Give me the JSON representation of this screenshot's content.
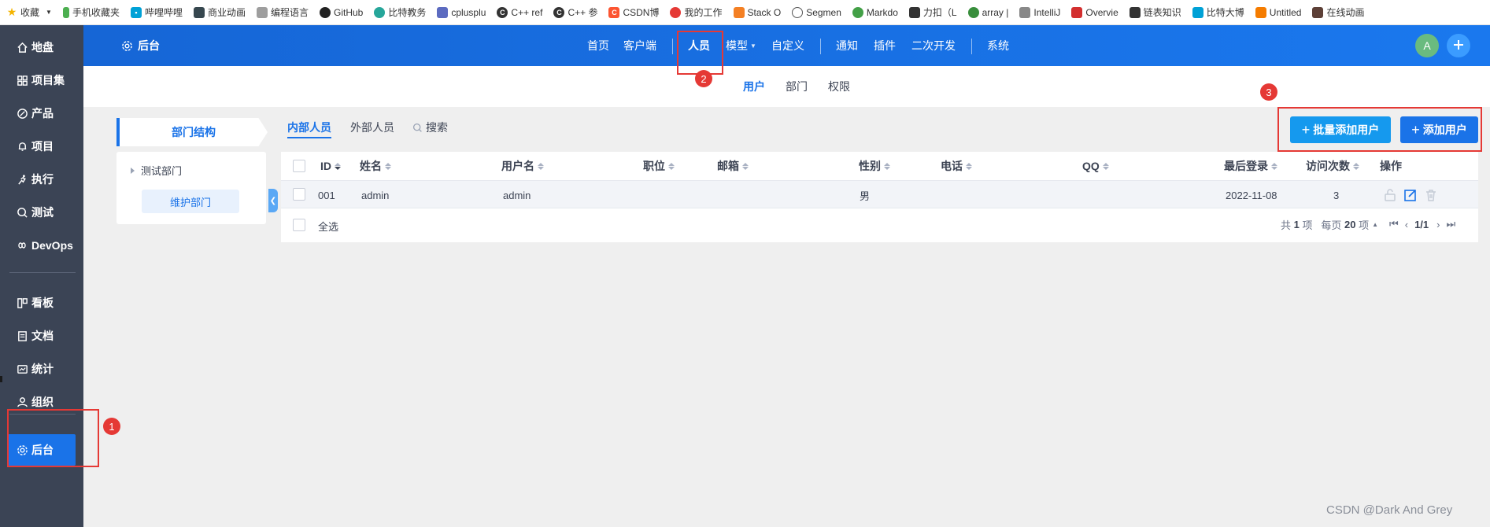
{
  "bookmarks": [
    {
      "label": "收藏",
      "icon": "star-icon",
      "color": "#f4b400"
    },
    {
      "label": "手机收藏夹",
      "icon": "phone-icon",
      "color": "#4caf50"
    },
    {
      "label": "哔哩哔哩",
      "icon": "bilibili-icon",
      "color": "#00a1d6"
    },
    {
      "label": "商业动画",
      "icon": "animation-icon",
      "color": "#37474f"
    },
    {
      "label": "编程语言",
      "icon": "code-icon",
      "color": "#9e9e9e"
    },
    {
      "label": "GitHub",
      "icon": "github-icon",
      "color": "#222222"
    },
    {
      "label": "比特教务",
      "icon": "leaf-icon",
      "color": "#26a69a"
    },
    {
      "label": "cplusplu",
      "icon": "cplusplus-icon",
      "color": "#5c6bc0"
    },
    {
      "label": "C++ ref",
      "icon": "cpp-icon",
      "color": "#333333"
    },
    {
      "label": "C++ 参",
      "icon": "cpp-icon",
      "color": "#333333"
    },
    {
      "label": "CSDN博",
      "icon": "csdn-icon",
      "color": "#fc5531"
    },
    {
      "label": "我的工作",
      "icon": "work-icon",
      "color": "#e53935"
    },
    {
      "label": "Stack O",
      "icon": "stackoverflow-icon",
      "color": "#f48024"
    },
    {
      "label": "Segmen",
      "icon": "globe-icon",
      "color": "#555555"
    },
    {
      "label": "Markdo",
      "icon": "markdown-icon",
      "color": "#43a047"
    },
    {
      "label": "力扣（L",
      "icon": "leetcode-icon",
      "color": "#333333"
    },
    {
      "label": "array |",
      "icon": "array-icon",
      "color": "#388e3c"
    },
    {
      "label": "IntelliJ",
      "icon": "intellij-icon",
      "color": "#888888"
    },
    {
      "label": "Overvie",
      "icon": "overview-icon",
      "color": "#d32f2f"
    },
    {
      "label": "链表知识",
      "icon": "leetcode-icon",
      "color": "#333333"
    },
    {
      "label": "比特大博",
      "icon": "bilibili-icon",
      "color": "#00a1d6"
    },
    {
      "label": "Untitled",
      "icon": "grid-icon",
      "color": "#f57c00"
    },
    {
      "label": "在线动画",
      "icon": "anime-icon",
      "color": "#5d4037"
    }
  ],
  "sidebar": {
    "items": [
      {
        "label": "地盘",
        "icon": "home-icon"
      },
      {
        "label": "项目集",
        "icon": "grid-icon"
      },
      {
        "label": "产品",
        "icon": "product-icon"
      },
      {
        "label": "项目",
        "icon": "bell-icon"
      },
      {
        "label": "执行",
        "icon": "run-icon"
      },
      {
        "label": "测试",
        "icon": "test-icon"
      },
      {
        "label": "DevOps",
        "icon": "infinity-icon"
      },
      {
        "label": "看板",
        "icon": "board-icon"
      },
      {
        "label": "文档",
        "icon": "doc-icon"
      },
      {
        "label": "统计",
        "icon": "chart-icon"
      },
      {
        "label": "组织",
        "icon": "user-icon"
      },
      {
        "label": "后台",
        "icon": "gear-icon",
        "active": true
      }
    ]
  },
  "header": {
    "brand": "后台",
    "nav": [
      "首页",
      "客户端",
      "人员",
      "模型",
      "自定义",
      "通知",
      "插件",
      "二次开发",
      "系统"
    ],
    "active_nav": "人员",
    "avatar_letter": "A"
  },
  "subnav": {
    "items": [
      "用户",
      "部门",
      "权限"
    ],
    "active": "用户"
  },
  "dept": {
    "title": "部门结构",
    "tree_root": "测试部门",
    "tree_child": "维护部门"
  },
  "tabs": {
    "internal": "内部人员",
    "external": "外部人员",
    "search": "搜索"
  },
  "buttons": {
    "batch_add": "批量添加用户",
    "add": "添加用户"
  },
  "table": {
    "columns": [
      "ID",
      "姓名",
      "用户名",
      "职位",
      "邮箱",
      "性别",
      "电话",
      "QQ",
      "最后登录",
      "访问次数",
      "操作"
    ],
    "rows": [
      {
        "id": "001",
        "name": "admin",
        "username": "admin",
        "position": "",
        "email": "",
        "gender": "男",
        "phone": "",
        "qq": "",
        "last_login": "2022-11-08",
        "visits": "3"
      }
    ],
    "select_all": "全选",
    "pager": {
      "total_prefix": "共",
      "total": "1",
      "total_suffix": "项",
      "per_page_prefix": "每页",
      "per_page": "20",
      "per_page_suffix": "项",
      "page": "1/1"
    }
  },
  "annotations": [
    "1",
    "2",
    "3"
  ],
  "watermark": "CSDN @Dark And Grey",
  "colors": {
    "primary": "#1a73e8",
    "sidebar": "#3b4455",
    "annotation": "#e53935"
  }
}
